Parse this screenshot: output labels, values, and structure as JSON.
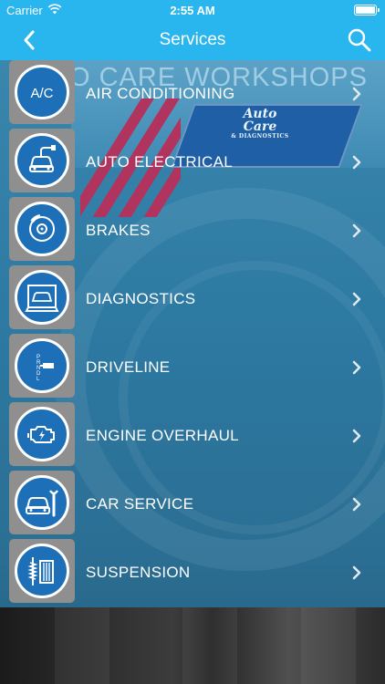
{
  "status_bar": {
    "carrier": "Carrier",
    "time": "2:55 AM",
    "battery_level": 1.0
  },
  "nav": {
    "title": "Services",
    "back_icon": "chevron-left-icon",
    "search_icon": "search-icon"
  },
  "background": {
    "banner_text": "O CARE WORKSHOPS",
    "logo_line1": "Auto",
    "logo_line2": "Care",
    "logo_sub": "& DIAGNOSTICS"
  },
  "services": [
    {
      "label": "AIR CONDITIONING",
      "icon": "ac-icon",
      "icon_text": "A/C"
    },
    {
      "label": "AUTO ELECTRICAL",
      "icon": "car-plug-icon"
    },
    {
      "label": "BRAKES",
      "icon": "brake-disc-icon"
    },
    {
      "label": "DIAGNOSTICS",
      "icon": "diagnostic-car-icon"
    },
    {
      "label": "DRIVELINE",
      "icon": "gear-shift-icon",
      "icon_text": "PRNDL"
    },
    {
      "label": "ENGINE OVERHAUL",
      "icon": "engine-icon"
    },
    {
      "label": "CAR SERVICE",
      "icon": "car-wrench-icon"
    },
    {
      "label": "SUSPENSION",
      "icon": "shock-absorber-icon"
    }
  ],
  "colors": {
    "nav_bar": "#29b6ee",
    "icon_circle": "#1d6fb7",
    "icon_tile": "#8f8f8f"
  }
}
